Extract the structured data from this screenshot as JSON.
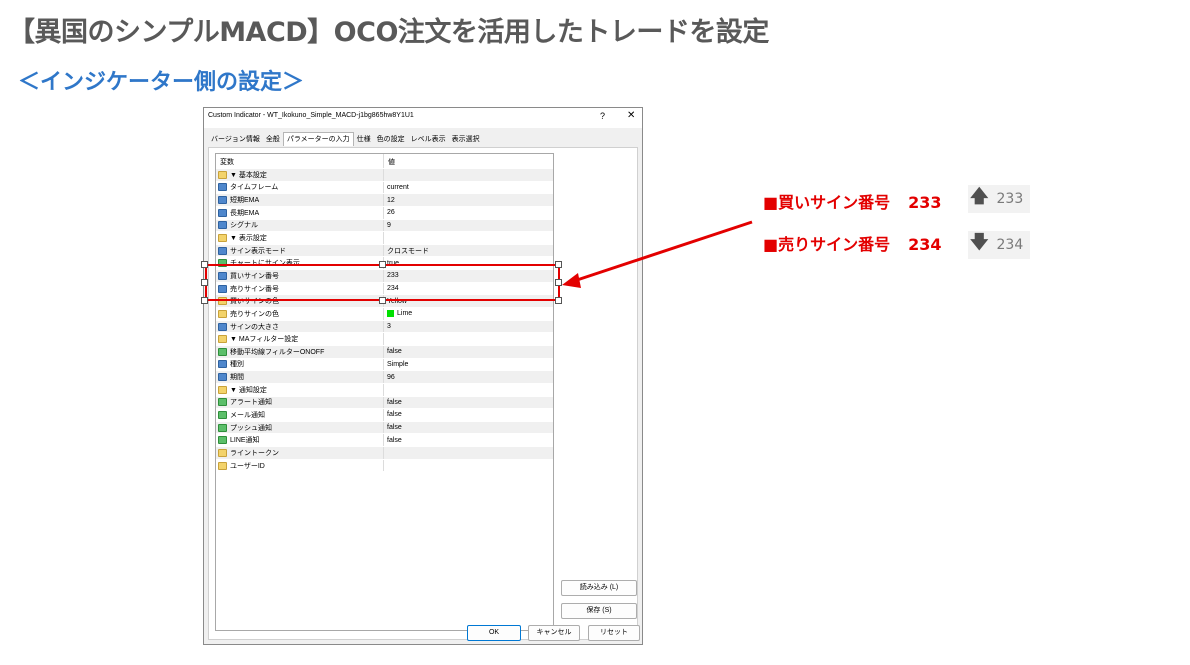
{
  "heading": "【異国のシンプルMACD】OCO注文を活用したトレードを設定",
  "subheading": "＜インジケーター側の設定＞",
  "dialog": {
    "title": "Custom Indicator - WT_Ikokuno_Simple_MACD-j1bg865hw8Y1U1",
    "help": "?",
    "close": "✕",
    "tabs": [
      "バージョン情報",
      "全般",
      "パラメーターの入力",
      "仕様",
      "色の設定",
      "レベル表示",
      "表示選択"
    ],
    "active_tab": 2,
    "columns": [
      "変数",
      "値"
    ],
    "rows": [
      {
        "icon": "ab",
        "name": "▼ 基本設定",
        "value": ""
      },
      {
        "icon": "n",
        "name": "タイムフレーム",
        "value": "current"
      },
      {
        "icon": "n",
        "name": "短期EMA",
        "value": "12"
      },
      {
        "icon": "n",
        "name": "長期EMA",
        "value": "26"
      },
      {
        "icon": "n",
        "name": "シグナル",
        "value": "9"
      },
      {
        "icon": "ab",
        "name": "▼ 表示設定",
        "value": ""
      },
      {
        "icon": "n",
        "name": "サイン表示モード",
        "value": "クロスモード"
      },
      {
        "icon": "b",
        "name": "チャートにサイン表示",
        "value": "true"
      },
      {
        "icon": "n",
        "name": "買いサイン番号",
        "value": "233"
      },
      {
        "icon": "n",
        "name": "売りサイン番号",
        "value": "234"
      },
      {
        "icon": "clr",
        "name": "買いサインの色",
        "value": "Yellow"
      },
      {
        "icon": "clr",
        "name": "売りサインの色",
        "value": "Lime"
      },
      {
        "icon": "n",
        "name": "サインの大きさ",
        "value": "3"
      },
      {
        "icon": "ab",
        "name": "▼ MAフィルター設定",
        "value": ""
      },
      {
        "icon": "b",
        "name": "移動平均線フィルターONOFF",
        "value": "false"
      },
      {
        "icon": "n",
        "name": "種別",
        "value": "Simple"
      },
      {
        "icon": "n",
        "name": "期間",
        "value": "96"
      },
      {
        "icon": "ab",
        "name": "▼ 通知設定",
        "value": ""
      },
      {
        "icon": "b",
        "name": "アラート通知",
        "value": "false"
      },
      {
        "icon": "b",
        "name": "メール通知",
        "value": "false"
      },
      {
        "icon": "b",
        "name": "プッシュ通知",
        "value": "false"
      },
      {
        "icon": "b",
        "name": "LINE通知",
        "value": "false"
      },
      {
        "icon": "ab",
        "name": "ライントークン",
        "value": ""
      },
      {
        "icon": "ab",
        "name": "ユーザーID",
        "value": ""
      }
    ],
    "buttons": {
      "load": "読み込み (L)",
      "save": "保存 (S)",
      "ok": "OK",
      "cancel": "キャンセル",
      "reset": "リセット"
    }
  },
  "annotation": {
    "buy_label": "■買いサイン番号",
    "buy_number": "233",
    "buy_icon": "arrow-up-icon",
    "buy_icon_label": "233",
    "sell_label": "■売りサイン番号",
    "sell_number": "234",
    "sell_icon": "arrow-down-icon",
    "sell_icon_label": "234",
    "color": "#e30000"
  }
}
